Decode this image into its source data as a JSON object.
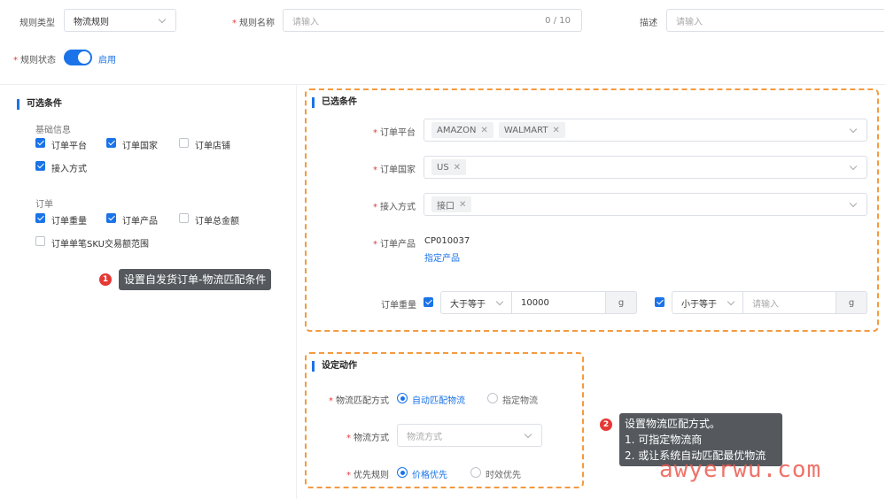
{
  "header": {
    "rule_type_label": "规则类型",
    "rule_type_value": "物流规则",
    "rule_name_label": "规则名称",
    "rule_name_placeholder": "请输入",
    "rule_name_count": "0 / 10",
    "desc_label": "描述",
    "desc_placeholder": "请输入",
    "status_label": "规则状态",
    "status_value": "启用"
  },
  "optional": {
    "title": "可选条件",
    "basic_group": "基础信息",
    "basic_items": [
      {
        "label": "订单平台",
        "checked": true
      },
      {
        "label": "订单国家",
        "checked": true
      },
      {
        "label": "订单店铺",
        "checked": false
      },
      {
        "label": "接入方式",
        "checked": true
      }
    ],
    "order_group": "订单",
    "order_items": [
      {
        "label": "订单重量",
        "checked": true
      },
      {
        "label": "订单产品",
        "checked": true
      },
      {
        "label": "订单总金额",
        "checked": false
      },
      {
        "label": "订单单笔SKU交易额范围",
        "checked": false
      }
    ]
  },
  "selected": {
    "title": "已选条件",
    "platform_label": "订单平台",
    "platform_tags": [
      "AMAZON",
      "WALMART"
    ],
    "country_label": "订单国家",
    "country_tags": [
      "US"
    ],
    "access_label": "接入方式",
    "access_tags": [
      "接口"
    ],
    "product_label": "订单产品",
    "product_value": "CP010037",
    "product_link": "指定产品",
    "weight_label": "订单重量",
    "weight_op1": "大于等于",
    "weight_val1": "10000",
    "weight_unit1": "g",
    "weight_op2": "小于等于",
    "weight_placeholder2": "请输入",
    "weight_unit2": "g"
  },
  "action": {
    "title": "设定动作",
    "match_label": "物流匹配方式",
    "match_opt1": "自动匹配物流",
    "match_opt2": "指定物流",
    "method_label": "物流方式",
    "method_placeholder": "物流方式",
    "priority_label": "优先规则",
    "priority_opt1": "价格优先",
    "priority_opt2": "时效优先"
  },
  "annotations": {
    "badge1": "1",
    "tip1": "设置自发货订单-物流匹配条件",
    "badge2": "2",
    "tip2_line1": "设置物流匹配方式。",
    "tip2_line2": "1. 可指定物流商",
    "tip2_line3": "2. 或让系统自动匹配最优物流"
  },
  "watermark": "awyerwu.com",
  "colors": {
    "accent": "#1a73e8",
    "dash": "#f39a3f",
    "badge": "#e53935"
  }
}
